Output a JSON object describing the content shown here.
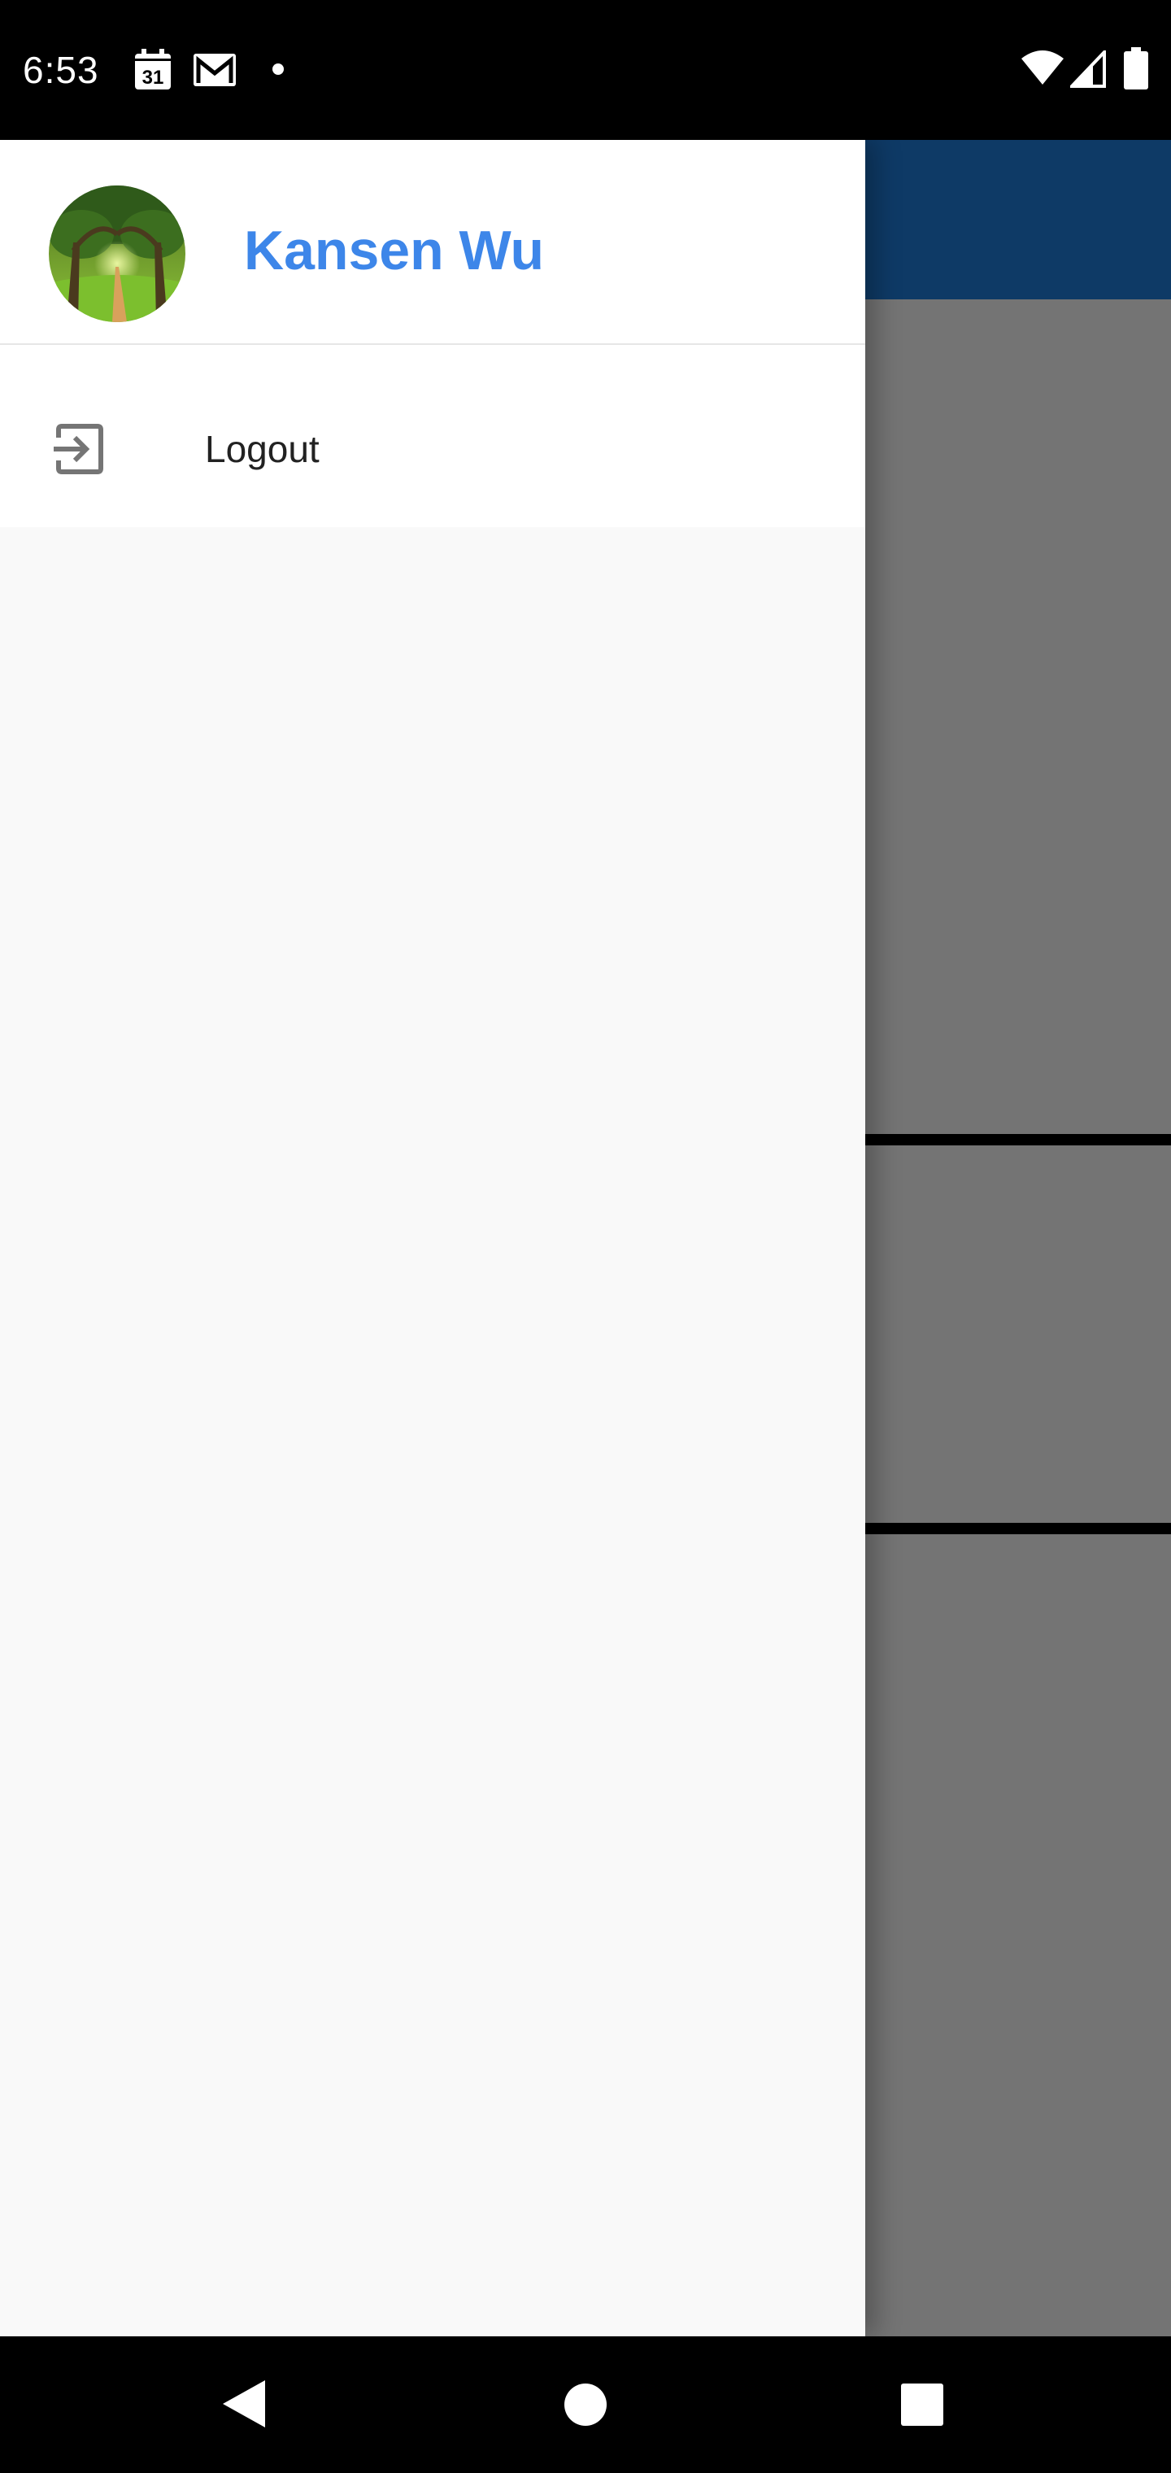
{
  "status_bar": {
    "time": "6:53",
    "calendar_day": "31",
    "left_icons": [
      "calendar-icon",
      "gmail-icon",
      "notification-dot-icon"
    ],
    "right_icons": [
      "wifi-icon",
      "cell-signal-icon",
      "battery-icon"
    ]
  },
  "drawer": {
    "user_name": "Kansen Wu",
    "avatar": "tree-tunnel-avatar",
    "items": [
      {
        "label": "Logout",
        "icon": "logout-icon"
      }
    ]
  },
  "nav_bar": {
    "buttons": [
      "back-icon",
      "home-icon",
      "recents-icon"
    ]
  },
  "colors": {
    "user_name": "#3d86e9",
    "app_toolbar": "#1f7ad6",
    "drawer_bg": "#f9f9f9",
    "drawer_header_bg": "#ffffff"
  }
}
